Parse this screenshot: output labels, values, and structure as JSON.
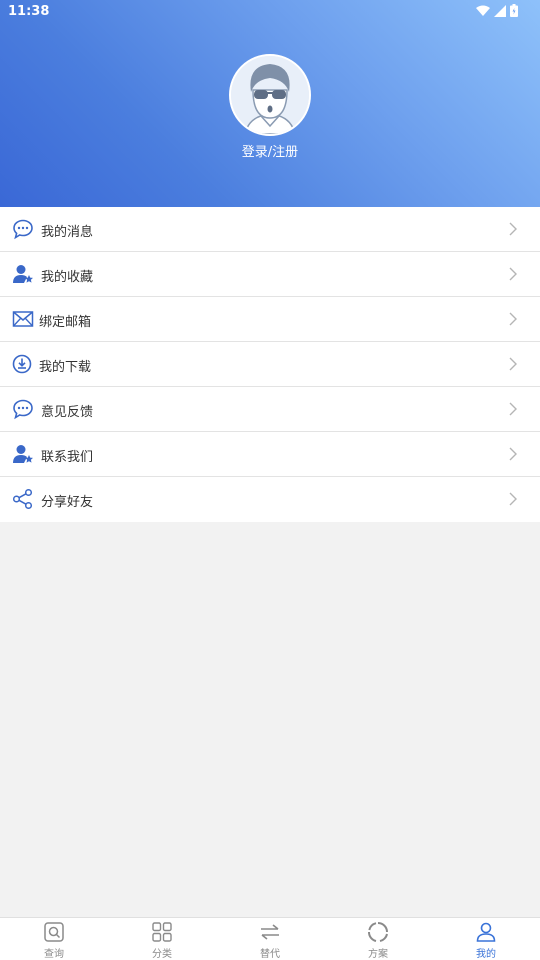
{
  "status_bar": {
    "time": "11:38"
  },
  "profile": {
    "login_text": "登录/注册"
  },
  "menu": [
    {
      "label": "我的消息",
      "icon": "chat-bubble-icon"
    },
    {
      "label": "我的收藏",
      "icon": "user-star-icon"
    },
    {
      "label": "绑定邮箱",
      "icon": "envelope-icon"
    },
    {
      "label": "我的下载",
      "icon": "download-icon"
    },
    {
      "label": "意见反馈",
      "icon": "chat-bubble-icon"
    },
    {
      "label": "联系我们",
      "icon": "user-star-icon"
    },
    {
      "label": "分享好友",
      "icon": "share-icon"
    }
  ],
  "tabs": [
    {
      "label": "查询",
      "icon": "search-icon",
      "active": false
    },
    {
      "label": "分类",
      "icon": "grid-icon",
      "active": false
    },
    {
      "label": "替代",
      "icon": "swap-icon",
      "active": false
    },
    {
      "label": "方案",
      "icon": "loading-circle-icon",
      "active": false
    },
    {
      "label": "我的",
      "icon": "person-icon",
      "active": true
    }
  ],
  "colors": {
    "accent": "#3a73d8",
    "icon_blue": "#3a68c8",
    "header_start": "#3a68d6",
    "header_end": "#8ec1fa"
  }
}
